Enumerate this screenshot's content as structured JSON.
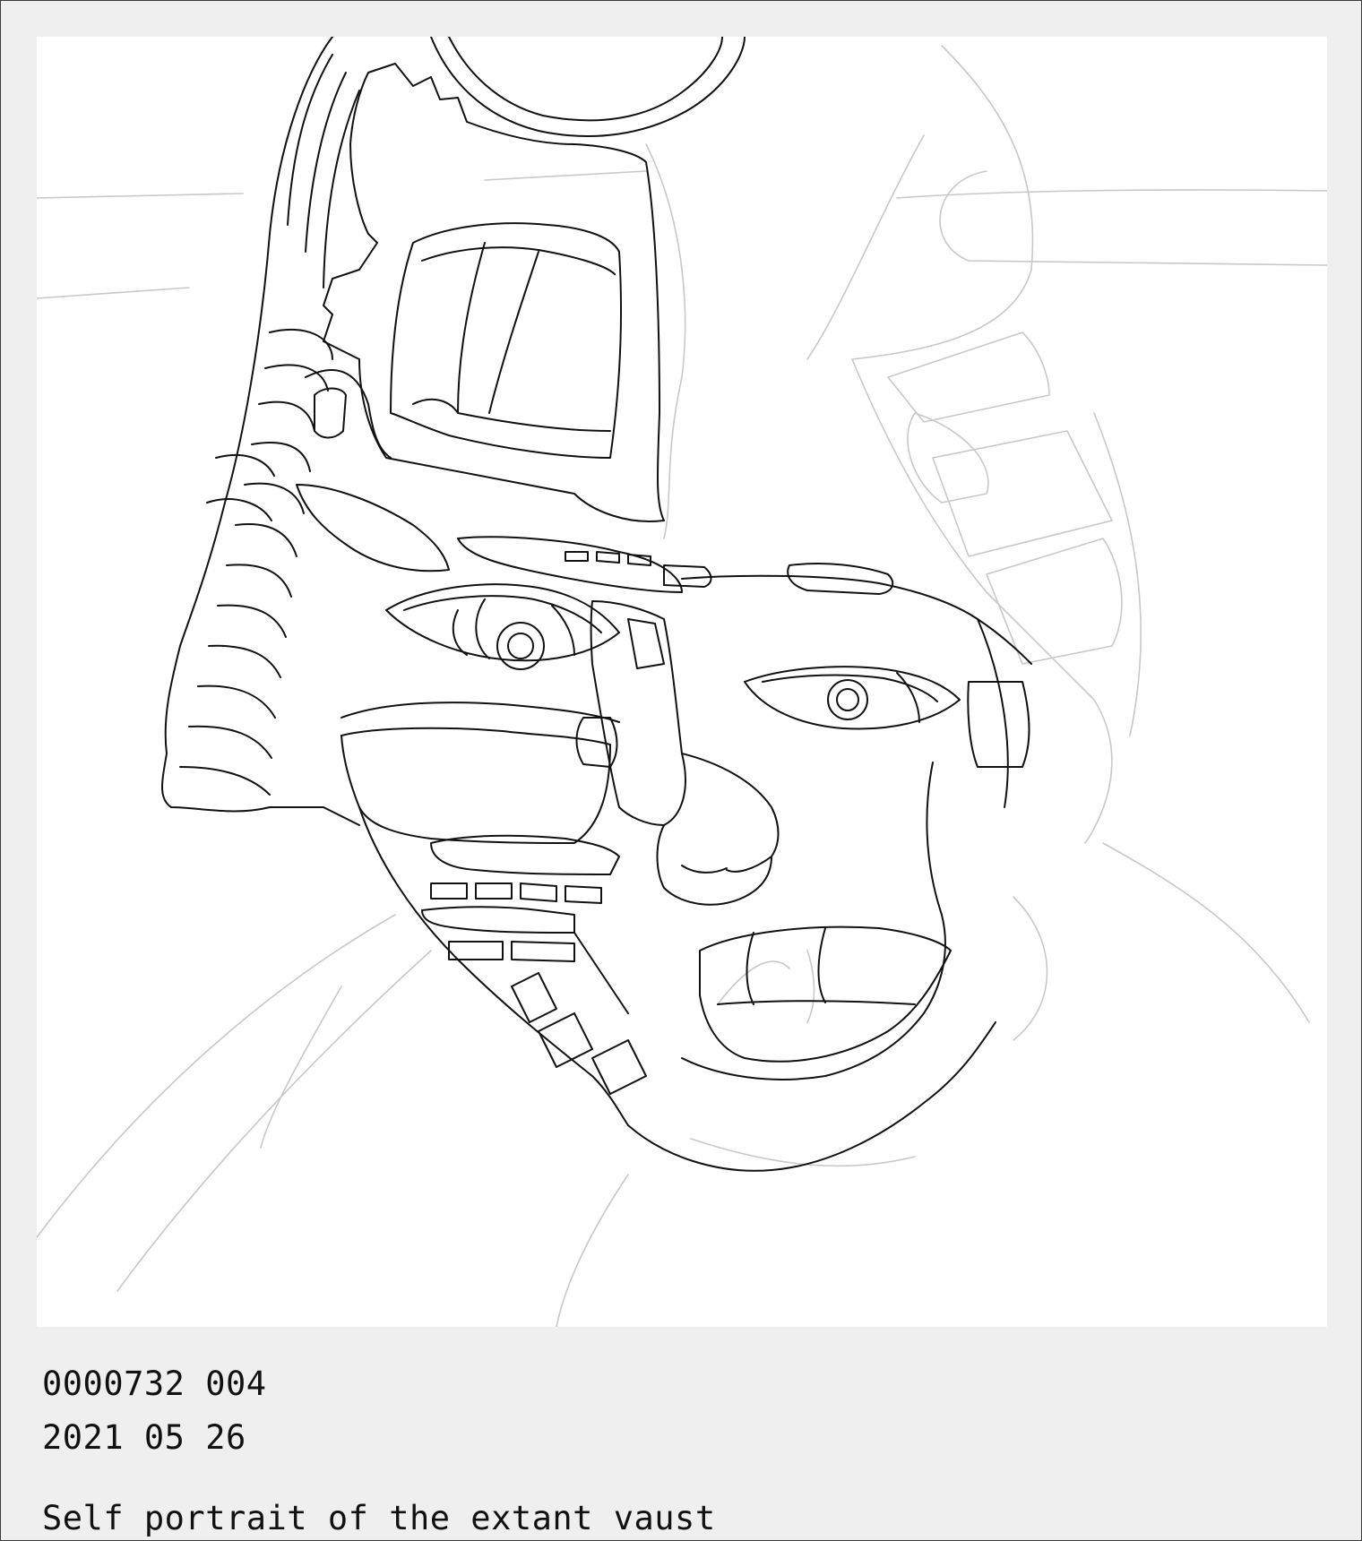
{
  "caption": {
    "catalog_number": "0000732 004",
    "date": "2021 05 26",
    "title": "Self portrait of the extant vaust"
  },
  "colors": {
    "card_background": "#efefef",
    "artwork_background": "#ffffff",
    "ink": "#111111",
    "ghost_lines": "#c8c8c8"
  }
}
